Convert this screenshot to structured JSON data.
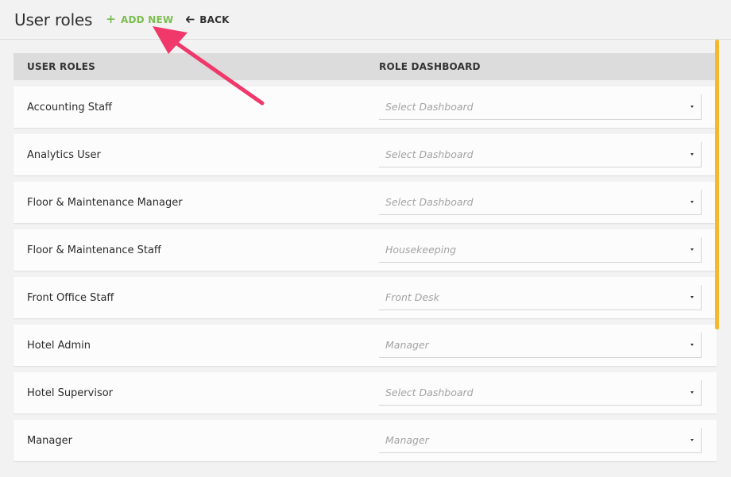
{
  "header": {
    "title": "User roles",
    "add_new_label": "ADD NEW",
    "back_label": "BACK"
  },
  "table": {
    "col_roles": "USER ROLES",
    "col_dashboard": "ROLE DASHBOARD",
    "rows": [
      {
        "role": "Accounting Staff",
        "dashboard": "Select Dashboard"
      },
      {
        "role": "Analytics User",
        "dashboard": "Select Dashboard"
      },
      {
        "role": "Floor & Maintenance Manager",
        "dashboard": "Select Dashboard"
      },
      {
        "role": "Floor & Maintenance Staff",
        "dashboard": "Housekeeping"
      },
      {
        "role": "Front Office Staff",
        "dashboard": "Front Desk"
      },
      {
        "role": "Hotel Admin",
        "dashboard": "Manager"
      },
      {
        "role": "Hotel Supervisor",
        "dashboard": "Select Dashboard"
      },
      {
        "role": "Manager",
        "dashboard": "Manager"
      }
    ]
  },
  "colors": {
    "accent_green": "#7bbd4f",
    "scrollbar": "#f3b92e",
    "annotation_arrow": "#f0386b"
  },
  "icons": {
    "add": "plus-icon",
    "back": "arrow-left-icon",
    "select": "caret-down-icon"
  }
}
